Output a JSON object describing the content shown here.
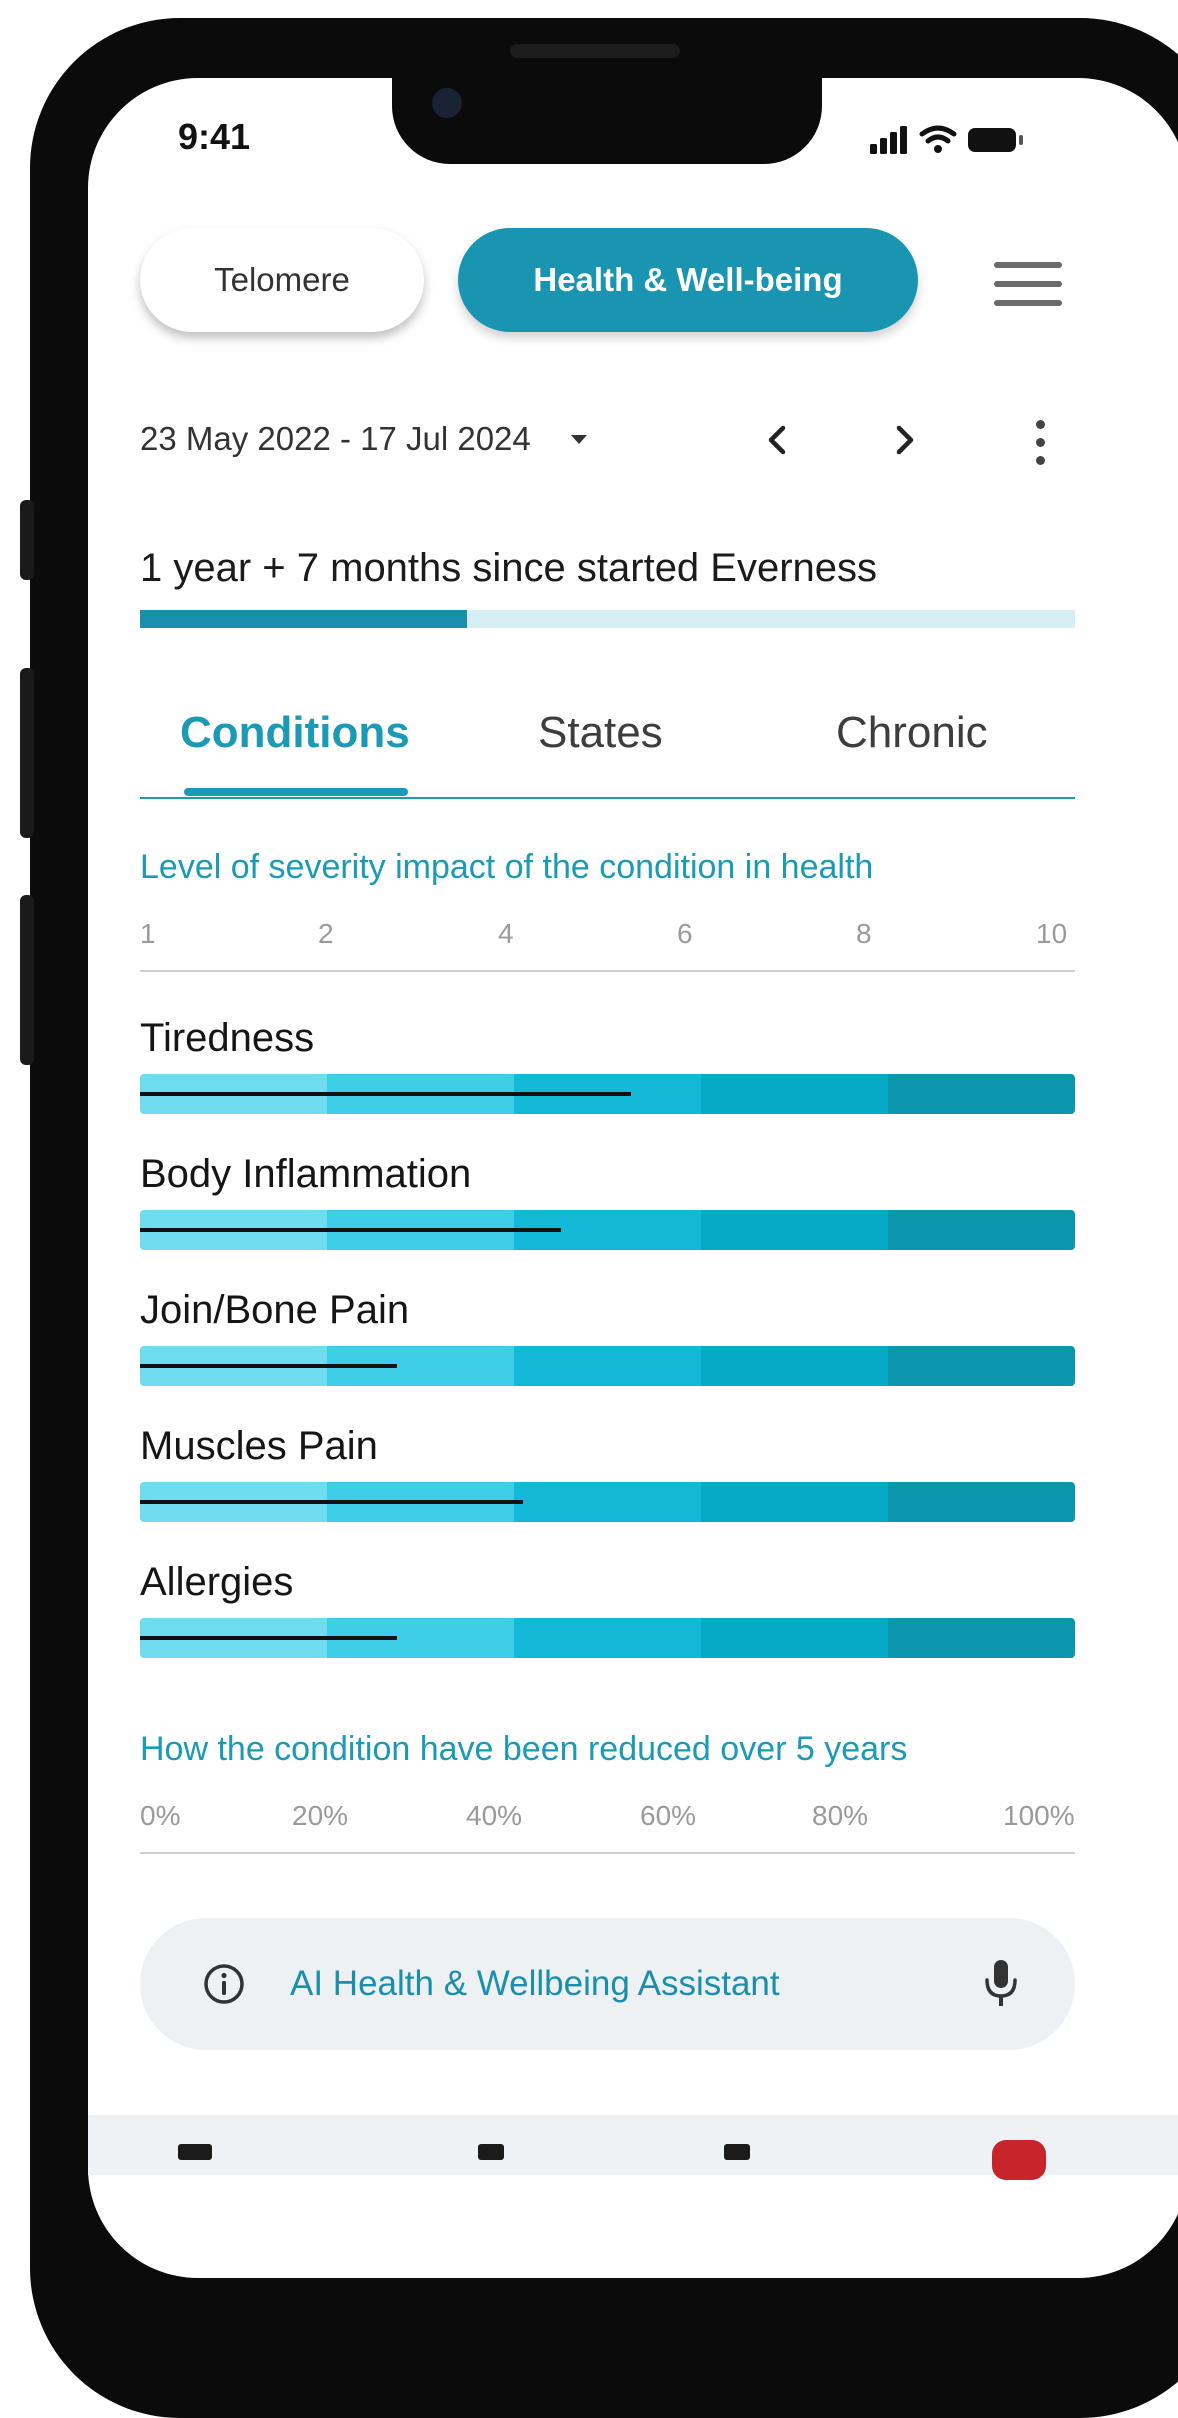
{
  "status_bar": {
    "time": "9:41"
  },
  "header": {
    "segments": [
      {
        "label": "Telomere",
        "active": false
      },
      {
        "label": "Health & Well-being",
        "active": true
      }
    ],
    "menu_icon": "hamburger-menu-icon",
    "accent_color": "#1a95b1"
  },
  "date_bar": {
    "range": "23 May 2022 - 17 Jul 2024",
    "prev_icon": "chevron-left-icon",
    "next_icon": "chevron-right-icon",
    "more_icon": "more-vertical-icon"
  },
  "program": {
    "since_text": "1 year + 7 months since started Everness",
    "progress_fraction": 0.35
  },
  "tabs": [
    {
      "label": "Conditions",
      "active": true
    },
    {
      "label": "States",
      "active": false
    },
    {
      "label": "Chronic",
      "active": false
    }
  ],
  "severity_scale": {
    "title": "Level of severity impact of the condition in health",
    "ticks": [
      "1",
      "2",
      "4",
      "6",
      "8",
      "10"
    ]
  },
  "conditions": [
    {
      "label": "Tiredness",
      "severity_fraction": 0.525
    },
    {
      "label": "Body Inflammation",
      "severity_fraction": 0.45
    },
    {
      "label": "Join/Bone Pain",
      "severity_fraction": 0.275
    },
    {
      "label": "Muscles Pain",
      "severity_fraction": 0.41
    },
    {
      "label": "Allergies",
      "severity_fraction": 0.275
    }
  ],
  "band_colors": [
    "#6fdcef",
    "#3ecde6",
    "#12bad8",
    "#06a9c6",
    "#0c96ae"
  ],
  "reduction_scale": {
    "title": "How the condition have been reduced over 5 years",
    "ticks": [
      "0%",
      "20%",
      "40%",
      "60%",
      "80%",
      "100%"
    ]
  },
  "assistant": {
    "label": "AI Health & Wellbeing Assistant",
    "info_icon": "info-icon",
    "mic_icon": "microphone-icon"
  }
}
